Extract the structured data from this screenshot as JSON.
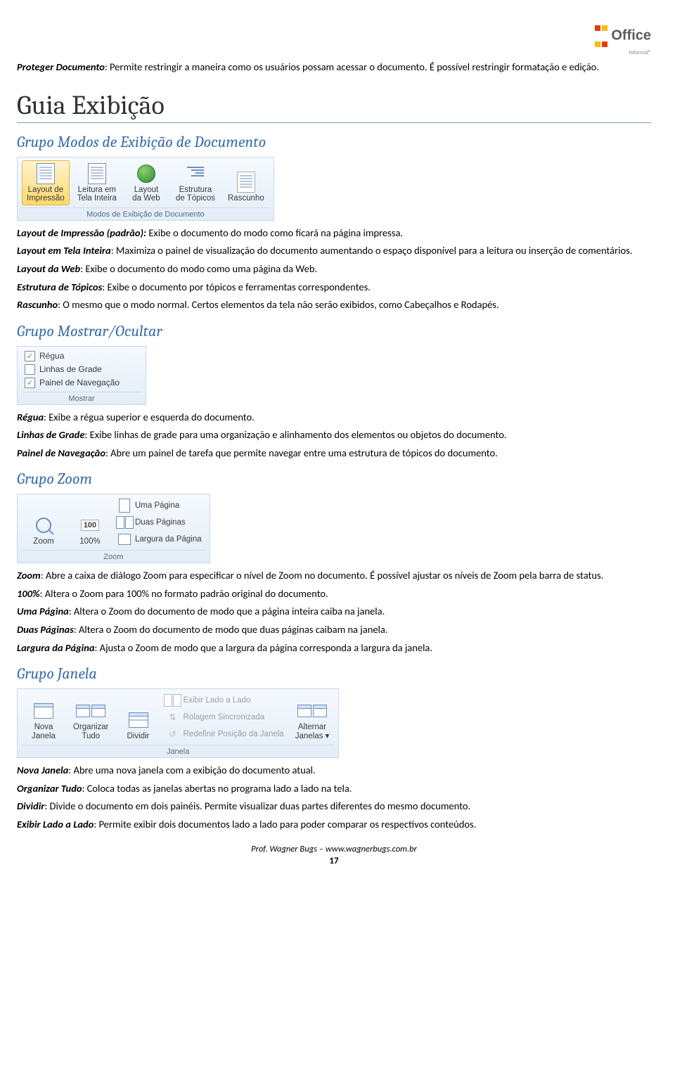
{
  "header": {
    "brand": "Office",
    "brand_sub": "Informal®"
  },
  "intro": {
    "proteger_label": "Proteger Documento",
    "proteger_text": ": Permite restringir a maneira como os usuários possam acessar o documento. É possível restringir formatação e edição."
  },
  "h1": "Guia Exibição",
  "sec1": {
    "title": "Grupo Modos de Exibição de Documento",
    "ribbon": {
      "btn1": "Layout de\nImpressão",
      "btn2": "Leitura em\nTela Inteira",
      "btn3": "Layout\nda Web",
      "btn4": "Estrutura\nde Tópicos",
      "btn5": "Rascunho",
      "group": "Modos de Exibição de Documento"
    },
    "l1_b": "Layout de Impressão (padrão):",
    "l1": " Exibe o documento do modo como ficará na página impressa.",
    "l2_b": "Layout em Tela Inteira",
    "l2": ": Maximiza o painel de visualização do documento aumentando o espaço disponível para a leitura ou inserção de comentários.",
    "l3_b": "Layout da Web",
    "l3": ": Exibe o documento do modo como uma página da Web.",
    "l4_b": "Estrutura de Tópicos",
    "l4": ": Exibe o documento por tópicos e ferramentas correspondentes.",
    "l5_b": "Rascunho",
    "l5": ": O mesmo que o modo normal. Certos elementos da tela não serão exibidos, como Cabeçalhos e Rodapés."
  },
  "sec2": {
    "title": "Grupo Mostrar/Ocultar",
    "ribbon": {
      "c1": "Régua",
      "c2": "Linhas de Grade",
      "c3": "Painel de Navegação",
      "group": "Mostrar"
    },
    "l1_b": "Régua",
    "l1": ": Exibe a régua superior e esquerda do documento.",
    "l2_b": "Linhas de Grade",
    "l2": ": Exibe linhas de grade para uma organização e alinhamento dos elementos ou objetos do documento.",
    "l3_b": "Painel de Navegação",
    "l3": ": Abre um painel de tarefa que permite navegar entre uma estrutura de tópicos do documento."
  },
  "sec3": {
    "title": "Grupo Zoom",
    "ribbon": {
      "b1": "Zoom",
      "b2": "100%",
      "b3": "Uma Página",
      "b4": "Duas Páginas",
      "b5": "Largura da Página",
      "group": "Zoom"
    },
    "l1_b": "Zoom",
    "l1": ": Abre a caixa de diálogo Zoom para especificar o nível de Zoom no documento. É possível ajustar os níveis de Zoom pela barra de status.",
    "l2_b": "100%",
    "l2": ": Altera o Zoom para 100% no formato padrão original do documento.",
    "l3_b": "Uma Página",
    "l3": ": Altera o Zoom do documento de modo que a página inteira caiba na janela.",
    "l4_b": "Duas Páginas",
    "l4": ": Altera o Zoom do documento de modo que duas páginas caibam na janela.",
    "l5_b": "Largura da Página",
    "l5": ": Ajusta o Zoom de modo que a largura da página corresponda a largura da janela."
  },
  "sec4": {
    "title": "Grupo Janela",
    "ribbon": {
      "b1": "Nova\nJanela",
      "b2": "Organizar\nTudo",
      "b3": "Dividir",
      "d1": "Exibir Lado a Lado",
      "d2": "Rolagem Sincronizada",
      "d3": "Redefinir Posição da Janela",
      "b4": "Alternar\nJanelas ▾",
      "group": "Janela"
    },
    "l1_b": "Nova Janela",
    "l1": ": Abre uma nova janela com a exibição do documento atual.",
    "l2_b": "Organizar Tudo",
    "l2": ": Coloca todas as janelas abertas no programa lado a lado na tela.",
    "l3_b": "Dividir",
    "l3": ": Divide o documento em dois painéis. Permite visualizar duas partes diferentes do mesmo documento.",
    "l4_b": "Exibir Lado a Lado",
    "l4": ": Permite exibir dois documentos lado a lado para poder comparar os respectivos conteúdos."
  },
  "footer": {
    "line": "Prof. Wagner Bugs – www.wagnerbugs.com.br",
    "page": "17"
  }
}
